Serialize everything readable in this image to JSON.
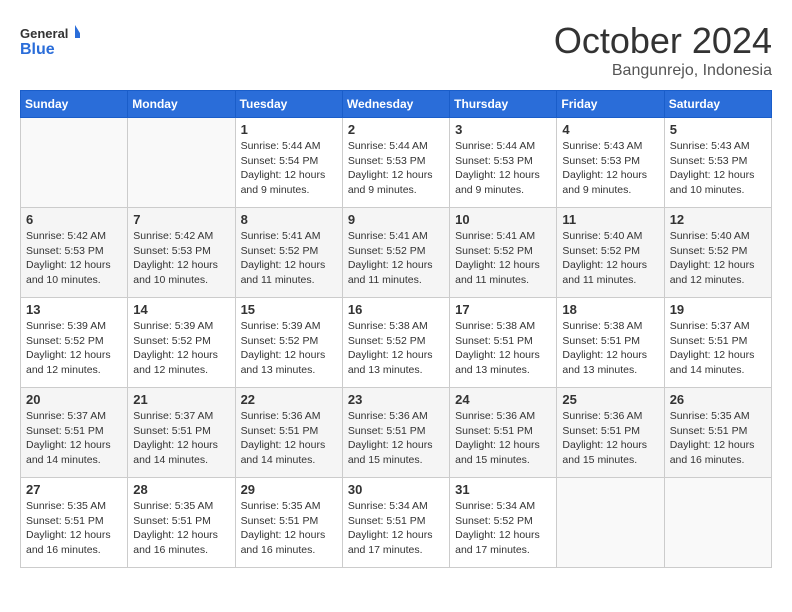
{
  "header": {
    "logo_general": "General",
    "logo_blue": "Blue",
    "month_title": "October 2024",
    "location": "Bangunrejo, Indonesia"
  },
  "weekdays": [
    "Sunday",
    "Monday",
    "Tuesday",
    "Wednesday",
    "Thursday",
    "Friday",
    "Saturday"
  ],
  "weeks": [
    [
      {
        "day": "",
        "sunrise": "",
        "sunset": "",
        "daylight": ""
      },
      {
        "day": "",
        "sunrise": "",
        "sunset": "",
        "daylight": ""
      },
      {
        "day": "1",
        "sunrise": "Sunrise: 5:44 AM",
        "sunset": "Sunset: 5:54 PM",
        "daylight": "Daylight: 12 hours and 9 minutes."
      },
      {
        "day": "2",
        "sunrise": "Sunrise: 5:44 AM",
        "sunset": "Sunset: 5:53 PM",
        "daylight": "Daylight: 12 hours and 9 minutes."
      },
      {
        "day": "3",
        "sunrise": "Sunrise: 5:44 AM",
        "sunset": "Sunset: 5:53 PM",
        "daylight": "Daylight: 12 hours and 9 minutes."
      },
      {
        "day": "4",
        "sunrise": "Sunrise: 5:43 AM",
        "sunset": "Sunset: 5:53 PM",
        "daylight": "Daylight: 12 hours and 9 minutes."
      },
      {
        "day": "5",
        "sunrise": "Sunrise: 5:43 AM",
        "sunset": "Sunset: 5:53 PM",
        "daylight": "Daylight: 12 hours and 10 minutes."
      }
    ],
    [
      {
        "day": "6",
        "sunrise": "Sunrise: 5:42 AM",
        "sunset": "Sunset: 5:53 PM",
        "daylight": "Daylight: 12 hours and 10 minutes."
      },
      {
        "day": "7",
        "sunrise": "Sunrise: 5:42 AM",
        "sunset": "Sunset: 5:53 PM",
        "daylight": "Daylight: 12 hours and 10 minutes."
      },
      {
        "day": "8",
        "sunrise": "Sunrise: 5:41 AM",
        "sunset": "Sunset: 5:52 PM",
        "daylight": "Daylight: 12 hours and 11 minutes."
      },
      {
        "day": "9",
        "sunrise": "Sunrise: 5:41 AM",
        "sunset": "Sunset: 5:52 PM",
        "daylight": "Daylight: 12 hours and 11 minutes."
      },
      {
        "day": "10",
        "sunrise": "Sunrise: 5:41 AM",
        "sunset": "Sunset: 5:52 PM",
        "daylight": "Daylight: 12 hours and 11 minutes."
      },
      {
        "day": "11",
        "sunrise": "Sunrise: 5:40 AM",
        "sunset": "Sunset: 5:52 PM",
        "daylight": "Daylight: 12 hours and 11 minutes."
      },
      {
        "day": "12",
        "sunrise": "Sunrise: 5:40 AM",
        "sunset": "Sunset: 5:52 PM",
        "daylight": "Daylight: 12 hours and 12 minutes."
      }
    ],
    [
      {
        "day": "13",
        "sunrise": "Sunrise: 5:39 AM",
        "sunset": "Sunset: 5:52 PM",
        "daylight": "Daylight: 12 hours and 12 minutes."
      },
      {
        "day": "14",
        "sunrise": "Sunrise: 5:39 AM",
        "sunset": "Sunset: 5:52 PM",
        "daylight": "Daylight: 12 hours and 12 minutes."
      },
      {
        "day": "15",
        "sunrise": "Sunrise: 5:39 AM",
        "sunset": "Sunset: 5:52 PM",
        "daylight": "Daylight: 12 hours and 13 minutes."
      },
      {
        "day": "16",
        "sunrise": "Sunrise: 5:38 AM",
        "sunset": "Sunset: 5:52 PM",
        "daylight": "Daylight: 12 hours and 13 minutes."
      },
      {
        "day": "17",
        "sunrise": "Sunrise: 5:38 AM",
        "sunset": "Sunset: 5:51 PM",
        "daylight": "Daylight: 12 hours and 13 minutes."
      },
      {
        "day": "18",
        "sunrise": "Sunrise: 5:38 AM",
        "sunset": "Sunset: 5:51 PM",
        "daylight": "Daylight: 12 hours and 13 minutes."
      },
      {
        "day": "19",
        "sunrise": "Sunrise: 5:37 AM",
        "sunset": "Sunset: 5:51 PM",
        "daylight": "Daylight: 12 hours and 14 minutes."
      }
    ],
    [
      {
        "day": "20",
        "sunrise": "Sunrise: 5:37 AM",
        "sunset": "Sunset: 5:51 PM",
        "daylight": "Daylight: 12 hours and 14 minutes."
      },
      {
        "day": "21",
        "sunrise": "Sunrise: 5:37 AM",
        "sunset": "Sunset: 5:51 PM",
        "daylight": "Daylight: 12 hours and 14 minutes."
      },
      {
        "day": "22",
        "sunrise": "Sunrise: 5:36 AM",
        "sunset": "Sunset: 5:51 PM",
        "daylight": "Daylight: 12 hours and 14 minutes."
      },
      {
        "day": "23",
        "sunrise": "Sunrise: 5:36 AM",
        "sunset": "Sunset: 5:51 PM",
        "daylight": "Daylight: 12 hours and 15 minutes."
      },
      {
        "day": "24",
        "sunrise": "Sunrise: 5:36 AM",
        "sunset": "Sunset: 5:51 PM",
        "daylight": "Daylight: 12 hours and 15 minutes."
      },
      {
        "day": "25",
        "sunrise": "Sunrise: 5:36 AM",
        "sunset": "Sunset: 5:51 PM",
        "daylight": "Daylight: 12 hours and 15 minutes."
      },
      {
        "day": "26",
        "sunrise": "Sunrise: 5:35 AM",
        "sunset": "Sunset: 5:51 PM",
        "daylight": "Daylight: 12 hours and 16 minutes."
      }
    ],
    [
      {
        "day": "27",
        "sunrise": "Sunrise: 5:35 AM",
        "sunset": "Sunset: 5:51 PM",
        "daylight": "Daylight: 12 hours and 16 minutes."
      },
      {
        "day": "28",
        "sunrise": "Sunrise: 5:35 AM",
        "sunset": "Sunset: 5:51 PM",
        "daylight": "Daylight: 12 hours and 16 minutes."
      },
      {
        "day": "29",
        "sunrise": "Sunrise: 5:35 AM",
        "sunset": "Sunset: 5:51 PM",
        "daylight": "Daylight: 12 hours and 16 minutes."
      },
      {
        "day": "30",
        "sunrise": "Sunrise: 5:34 AM",
        "sunset": "Sunset: 5:51 PM",
        "daylight": "Daylight: 12 hours and 17 minutes."
      },
      {
        "day": "31",
        "sunrise": "Sunrise: 5:34 AM",
        "sunset": "Sunset: 5:52 PM",
        "daylight": "Daylight: 12 hours and 17 minutes."
      },
      {
        "day": "",
        "sunrise": "",
        "sunset": "",
        "daylight": ""
      },
      {
        "day": "",
        "sunrise": "",
        "sunset": "",
        "daylight": ""
      }
    ]
  ]
}
